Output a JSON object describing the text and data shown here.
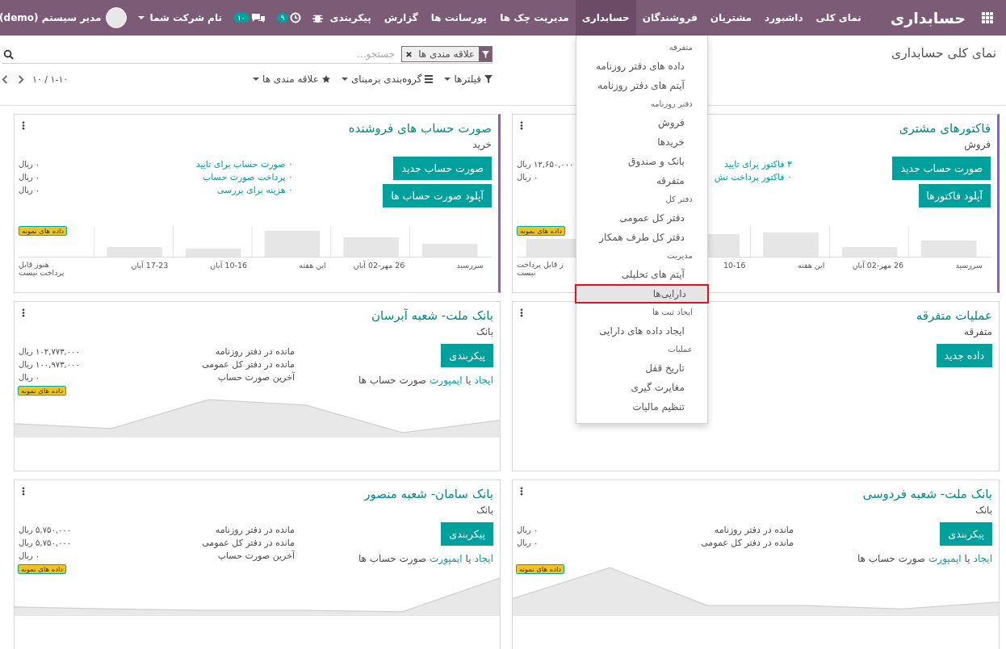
{
  "navbar": {
    "brand": "حسابداری",
    "menu": [
      {
        "label": "نمای کلی",
        "selected": false
      },
      {
        "label": "داشبورد",
        "selected": false
      },
      {
        "label": "مشتریان",
        "selected": false
      },
      {
        "label": "فروشندگان",
        "selected": false
      },
      {
        "label": "حسابداری",
        "selected": true
      },
      {
        "label": "مدیریت چک ها",
        "selected": false
      },
      {
        "label": "پورسانت ها",
        "selected": false
      },
      {
        "label": "گزارش",
        "selected": false
      },
      {
        "label": "پیکربندی",
        "selected": false
      }
    ],
    "activity_count": "۹",
    "message_count": "۱۰",
    "company": "نام شرکت شما",
    "user": "مدیر سیستم (demo)"
  },
  "dropdown": [
    {
      "kind": "header",
      "label": "متفرقه"
    },
    {
      "kind": "item",
      "label": "داده های دفتر روزنامه",
      "selected": false
    },
    {
      "kind": "item",
      "label": "آیتم های دفتر روزنامه",
      "selected": false
    },
    {
      "kind": "header",
      "label": "دفتر روزنامه"
    },
    {
      "kind": "item",
      "label": "فروش",
      "selected": false
    },
    {
      "kind": "item",
      "label": "خریدها",
      "selected": false
    },
    {
      "kind": "item",
      "label": "بانک و صندوق",
      "selected": false
    },
    {
      "kind": "item",
      "label": "متفرقه",
      "selected": false
    },
    {
      "kind": "header",
      "label": "دفتر کل"
    },
    {
      "kind": "item",
      "label": "دفتر کل عمومی",
      "selected": false
    },
    {
      "kind": "item",
      "label": "دفتر کل طرف همکار",
      "selected": false
    },
    {
      "kind": "header",
      "label": "مدیریت"
    },
    {
      "kind": "item",
      "label": "آیتم های تحلیلی",
      "selected": false
    },
    {
      "kind": "item",
      "label": "دارایی‌ها",
      "selected": true
    },
    {
      "kind": "header",
      "label": "ایجاد ثبت ها"
    },
    {
      "kind": "item",
      "label": "ایجاد داده های دارایی",
      "selected": false
    },
    {
      "kind": "header",
      "label": "عملیات"
    },
    {
      "kind": "item",
      "label": "تاریخ قفل",
      "selected": false
    },
    {
      "kind": "item",
      "label": "مغایرت گیری",
      "selected": false
    },
    {
      "kind": "item",
      "label": "تنظیم مالیات",
      "selected": false
    }
  ],
  "control_panel": {
    "title": "نمای کلی حسابداری",
    "search": {
      "facet": "علاقه مندی ها",
      "placeholder": "جستجو..."
    },
    "filters": "فیلترها",
    "group_by": "گروه‌بندی برمبنای",
    "favorites": "علاقه مندی ها",
    "pager": "۱-۱۰ / ۱۰"
  },
  "cards": [
    {
      "title": "فاکتورهای مشتری",
      "subtitle": "فروش",
      "favorite": true,
      "buttons": [
        "صورت حساب جدید",
        "آپلود فاکتورها"
      ],
      "stats": [
        {
          "label": "۳ فاکتور برای تایید",
          "link": true,
          "amount": "۱۲,۶۵۰,۰۰۰ ریال"
        },
        {
          "label": "۰ فاکتور پرداخت نش",
          "link": true,
          "amount": "۰ ریال"
        }
      ],
      "chart": {
        "kind": "bar",
        "badge": "داده های نمونه",
        "x_labels": [
          "سررسید",
          "26 مهر-02 آبان",
          "این هفته",
          "10-16",
          "ز قابل پرداخت نیست"
        ]
      }
    },
    {
      "title": "صورت حساب های فروشنده",
      "subtitle": "خرید",
      "favorite": true,
      "buttons": [
        "صورت حساب جدید",
        "آپلود صورت حساب ها"
      ],
      "stats": [
        {
          "label": "۰ صورت حساب برای تایید",
          "link": true,
          "amount": "۰ ریال"
        },
        {
          "label": "۰ پرداخت صورت حساب",
          "link": true,
          "amount": "۰ ریال"
        },
        {
          "label": "۰ هزینه برای بررسی",
          "link": true,
          "amount": "۰ ریال"
        }
      ],
      "chart": {
        "kind": "bar",
        "badge": "داده های نمونه",
        "x_labels": [
          "سررسید",
          "26 مهر-02 آبان",
          "این هفته",
          "10-16 آبان",
          "17-23 آبان",
          "هنوز قابل پرداخت نیست"
        ]
      }
    },
    {
      "title": "عملیات متفرقه",
      "subtitle": "متفرقه",
      "favorite": false,
      "buttons": [
        "داده جدید"
      ]
    },
    {
      "title": "بانک ملت- شعبه آبرسان",
      "subtitle": "بانک",
      "favorite": false,
      "buttons": [
        "پیکربندی"
      ],
      "import_line": [
        {
          "kind": "link",
          "text": "ایجاد"
        },
        {
          "kind": "text",
          "text": "یا"
        },
        {
          "kind": "link",
          "text": "ایمپورت"
        },
        {
          "kind": "text",
          "text": "صورت حساب ها"
        }
      ],
      "stats": [
        {
          "label": "مانده در دفتر روزنامه",
          "link": false,
          "amount": "۱۰۲,۷۷۳,۰۰۰ ریال"
        },
        {
          "label": "مانده در دفتر کل عمومی",
          "link": false,
          "amount": "۱۰۰,۹۷۳,۰۰۰ ریال"
        },
        {
          "label": "آخرین صورت حساب",
          "link": false,
          "amount": "۰ ریال"
        }
      ],
      "chart": {
        "kind": "line",
        "badge": "داده های نمونه"
      }
    },
    {
      "title": "بانک ملت- شعبه فردوسی",
      "subtitle": "بانک",
      "favorite": false,
      "buttons": [
        "پیکربندی"
      ],
      "import_line": [
        {
          "kind": "link",
          "text": "ایجاد"
        },
        {
          "kind": "text",
          "text": "یا"
        },
        {
          "kind": "link",
          "text": "ایمپورت"
        },
        {
          "kind": "text",
          "text": "صورت حساب ها"
        }
      ],
      "stats": [
        {
          "label": "مانده در دفتر روزنامه",
          "link": false,
          "amount": "۰ ریال"
        },
        {
          "label": "مانده در دفتر کل عمومی",
          "link": false,
          "amount": "۰ ریال"
        }
      ],
      "chart": {
        "kind": "line",
        "badge": "داده های نمونه"
      }
    },
    {
      "title": "بانک سامان- شعبه منصور",
      "subtitle": "بانک",
      "favorite": false,
      "buttons": [
        "پیکربندی"
      ],
      "import_line": [
        {
          "kind": "link",
          "text": "ایجاد"
        },
        {
          "kind": "text",
          "text": "یا"
        },
        {
          "kind": "link",
          "text": "ایمپورت"
        },
        {
          "kind": "text",
          "text": "صورت حساب ها"
        }
      ],
      "stats": [
        {
          "label": "مانده در دفتر روزنامه",
          "link": false,
          "amount": "۵,۷۵۰,۰۰۰ ریال"
        },
        {
          "label": "مانده در دفتر کل عمومی",
          "link": false,
          "amount": "۵,۷۵۰,۰۰۰ ریال"
        },
        {
          "label": "آخرین صورت حساب",
          "link": false,
          "amount": "۰ ریال"
        }
      ],
      "chart": {
        "kind": "line",
        "badge": "داده های نمونه"
      }
    }
  ]
}
